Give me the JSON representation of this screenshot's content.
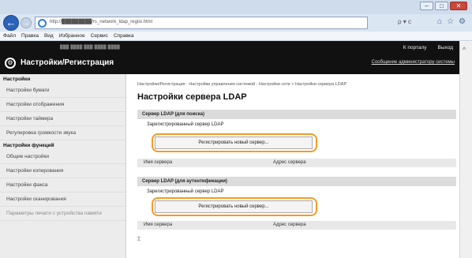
{
  "browser": {
    "window_controls": {
      "minimize": "–",
      "maximize": "□",
      "close": "✕"
    },
    "url": "http://█████████/rs_network_ldap_regist.html",
    "address_tools": "ρ ▾ с",
    "menu": [
      "Файл",
      "Правка",
      "Вид",
      "Избранное",
      "Сервис",
      "Справка"
    ]
  },
  "header": {
    "blurred_info": "███ ████  ███ ████ ████",
    "portal_link": "К порталу",
    "logout_link": "Выход",
    "title": "Настройки/Регистрация",
    "admin_message": "Сообщение администратору системы"
  },
  "sidebar": {
    "sections": [
      {
        "label": "Настройки",
        "items": [
          "Настройки бумаги",
          "Настройки отображения",
          "Настройки таймера",
          "Регулировка громкости звука"
        ]
      },
      {
        "label": "Настройки функций",
        "items": [
          "Общие настройки",
          "Настройки копирования",
          "Настройки факса",
          "Настройки сканирования",
          "Параметры печати с устройства памяти"
        ]
      }
    ]
  },
  "main": {
    "breadcrumb": "Настройки/Регистрация : Настройки управления системой : Настройки сети > Настройки сервера LDAP",
    "title": "Настройки сервера LDAP",
    "search_section": {
      "heading": "Сервер LDAP (для поиска)",
      "registered_label": "Зарегистрированный сервер LDAP",
      "register_button": "Регистрировать новый сервер...",
      "col_name": "Имя сервера",
      "col_address": "Адрес сервера"
    },
    "auth_section": {
      "heading": "Сервер LDAP (для аутентификации)",
      "registered_label": "Зарегистрированный сервер LDAP",
      "register_button": "Регистрировать новый сервер...",
      "col_name": "Имя сервера",
      "col_address": "Адрес сервера"
    },
    "footer_mark": "Σ"
  }
}
